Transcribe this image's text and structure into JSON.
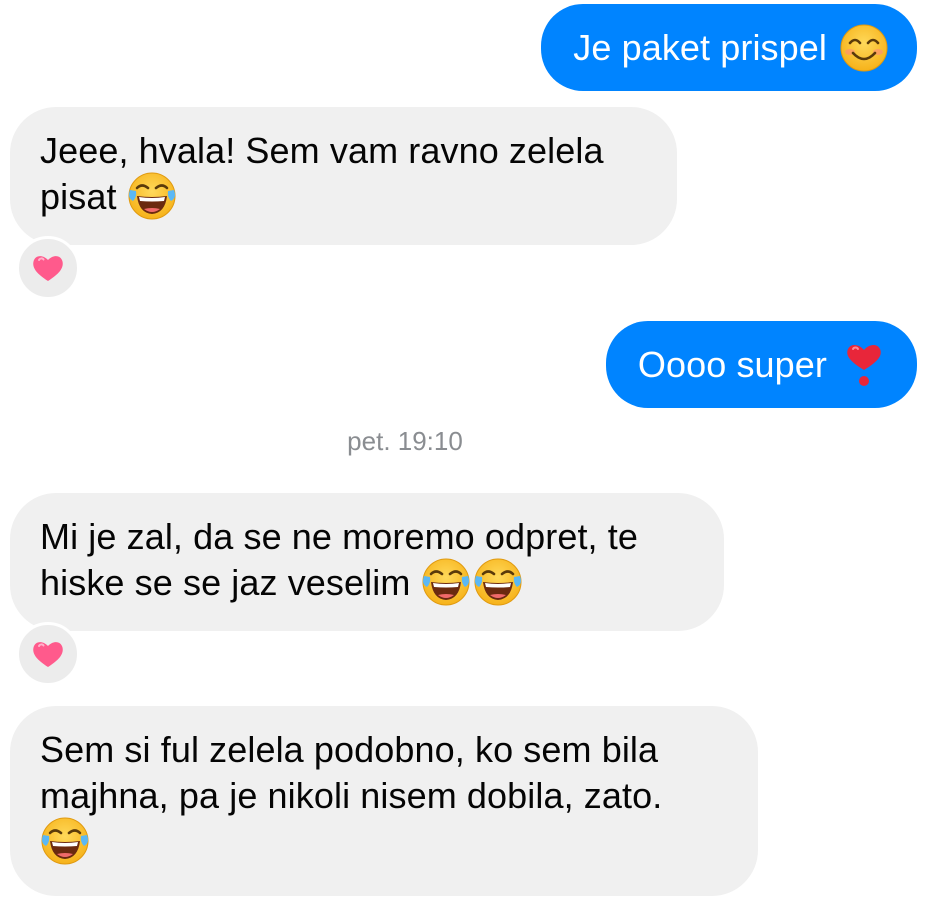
{
  "conversation": {
    "messages": [
      {
        "direction": "outgoing",
        "text": "Je paket prispel",
        "emoji": [
          "smiling-face-with-smiling-eyes"
        ]
      },
      {
        "direction": "incoming",
        "lines": [
          "Jeee, hvala! Sem vam ravno zelela",
          "pisat"
        ],
        "emoji": [
          "face-with-tears-of-joy"
        ],
        "reaction": "pink-heart"
      },
      {
        "direction": "outgoing",
        "text": "Oooo super",
        "emoji": [
          "heavy-heart-exclamation"
        ]
      },
      {
        "direction": "incoming",
        "lines": [
          "Mi je zal, da se ne moremo odpret, te",
          "hiske se se jaz veselim"
        ],
        "emoji": [
          "face-with-tears-of-joy",
          "face-with-tears-of-joy"
        ],
        "reaction": "pink-heart"
      },
      {
        "direction": "incoming",
        "lines": [
          "Sem si ful zelela podobno, ko sem bila",
          "majhna, pa je nikoli nisem dobila, zato."
        ],
        "emoji": [
          "face-with-tears-of-joy"
        ]
      }
    ],
    "timestamp": "pet. 19:10"
  },
  "colors": {
    "outgoing_bubble": "#0084ff",
    "incoming_bubble": "#f0f0f0",
    "timestamp_text": "#8a8d91"
  }
}
